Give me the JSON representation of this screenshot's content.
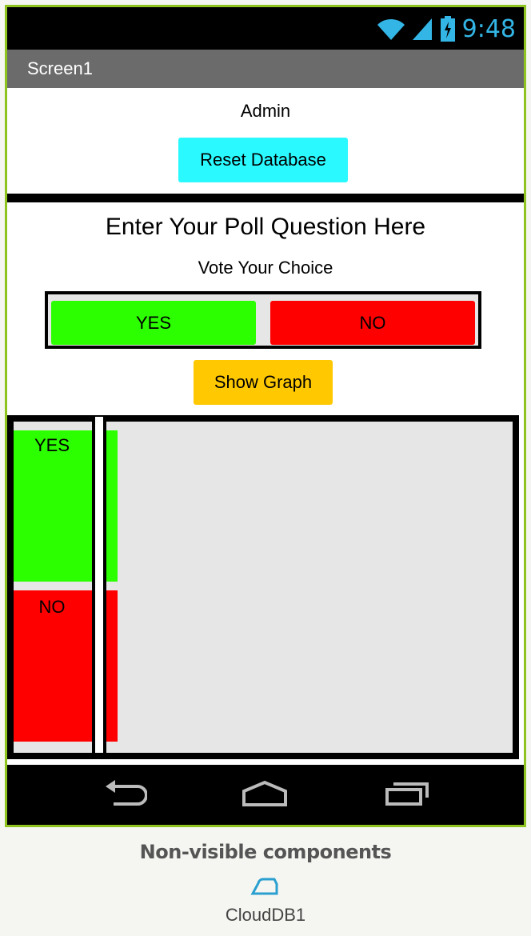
{
  "status_bar": {
    "time": "9:48"
  },
  "title_bar": {
    "title": "Screen1"
  },
  "admin": {
    "label": "Admin",
    "reset_button": "Reset Database"
  },
  "poll": {
    "question": "Enter Your Poll Question Here",
    "vote_prompt": "Vote Your Choice",
    "yes_button": "YES",
    "no_button": "NO",
    "show_graph_button": "Show Graph"
  },
  "graph": {
    "yes_label": "YES",
    "no_label": "NO"
  },
  "non_visible": {
    "heading": "Non-visible components",
    "components": [
      {
        "name": "CloudDB1",
        "icon": "cloud-icon"
      }
    ]
  },
  "colors": {
    "accent_border": "#8fc31f",
    "reset_button": "#2af9ff",
    "yes": "#2cff00",
    "no": "#ff0000",
    "show_graph": "#ffc800",
    "status_icons": "#33b5e5"
  }
}
